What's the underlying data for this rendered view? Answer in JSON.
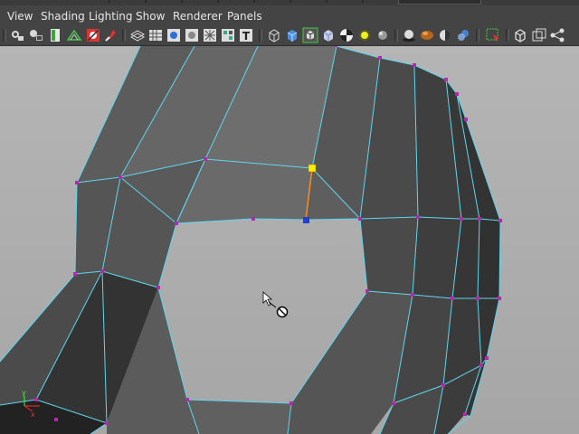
{
  "menubar": {
    "items": [
      {
        "label": "View"
      },
      {
        "label": "Shading"
      },
      {
        "label": "Lighting"
      },
      {
        "label": "Show"
      },
      {
        "label": "Renderer"
      },
      {
        "label": "Panels"
      }
    ]
  },
  "toolbar": {
    "text_icon_glyph": "T",
    "icons": [
      "camera-attributes-icon",
      "bookmark-icon",
      "image-plane-icon",
      "grid-icon",
      "film-gate-icon",
      "resolution-gate-icon",
      "gate-mask-icon",
      "safe-action-icon",
      "safe-title-icon",
      "wireframe-icon",
      "smooth-shade-icon",
      "default-material-icon",
      "x-ray-icon",
      "shaded-wireframe-icon",
      "texture-icon",
      "text-icon",
      "bounding-box-icon",
      "flat-shade-icon",
      "wireframe-on-shaded-icon",
      "backface-icon",
      "checker-icon",
      "use-all-lights-icon",
      "default-light-icon",
      "shadows-icon",
      "hardware-texture-icon",
      "ambient-occlusion-icon",
      "motion-blur-icon",
      "isolate-select-icon",
      "isolate-view-icon",
      "layout-single-icon",
      "layout-quad-icon"
    ]
  },
  "viewport": {
    "colors": {
      "background": "#acacac",
      "edge": "#5ed7ee",
      "vertex": "#b02ab0",
      "selected_vertex": "#ffee00",
      "target_vertex": "#1f3fd8",
      "active_edge": "#ff8c1a",
      "axis_x": "#ff2b2b",
      "axis_y": "#33ff33"
    },
    "cursor_icon": "move-vertex-cursor-icon",
    "axis_labels": {
      "y": "y",
      "x": "x"
    }
  }
}
